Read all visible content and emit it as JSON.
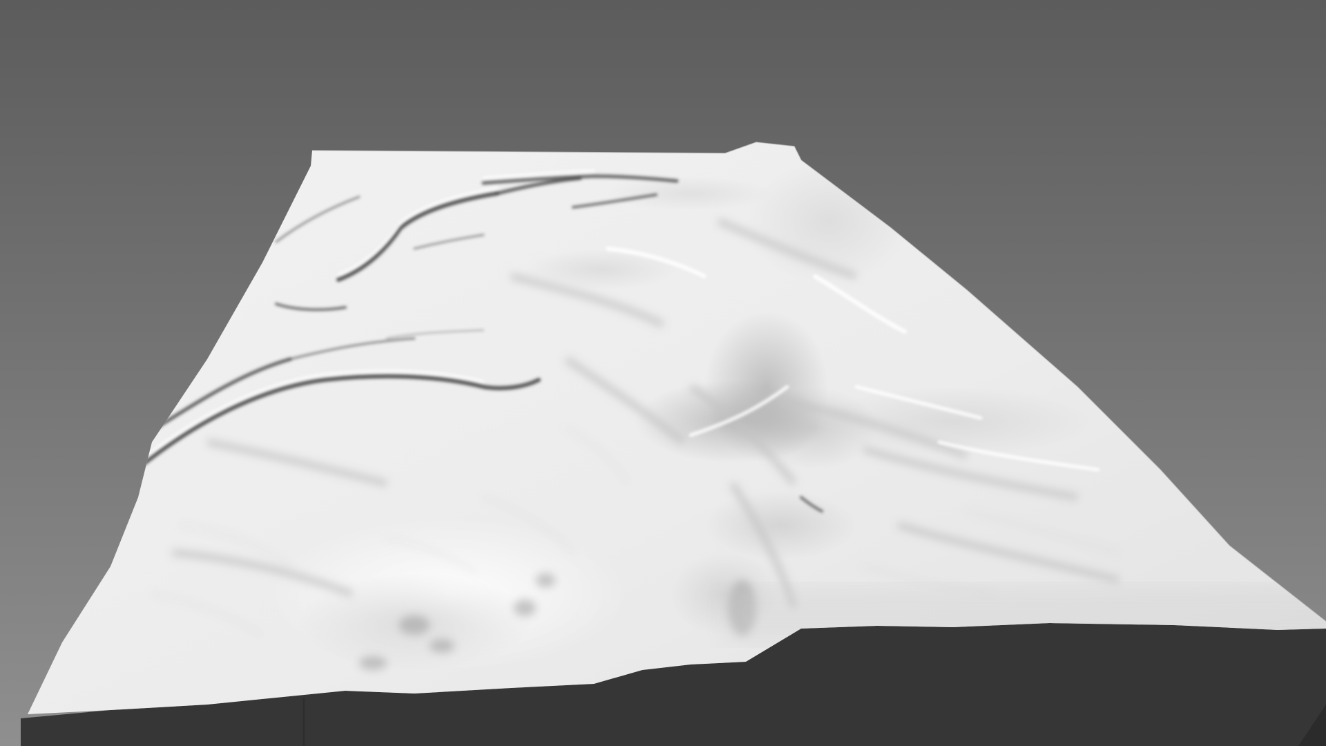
{
  "scene": {
    "subject": "terrain-relief-model",
    "background_top": "#5c5c5c",
    "background_bottom": "#8f8f8f",
    "terrain_color": "#ebebeb",
    "terrain_shadow": "#bdbdbd",
    "ridge_color": "#3f3f3f",
    "base_color": "#363636",
    "base_edge_color": "#2b2b2b"
  }
}
